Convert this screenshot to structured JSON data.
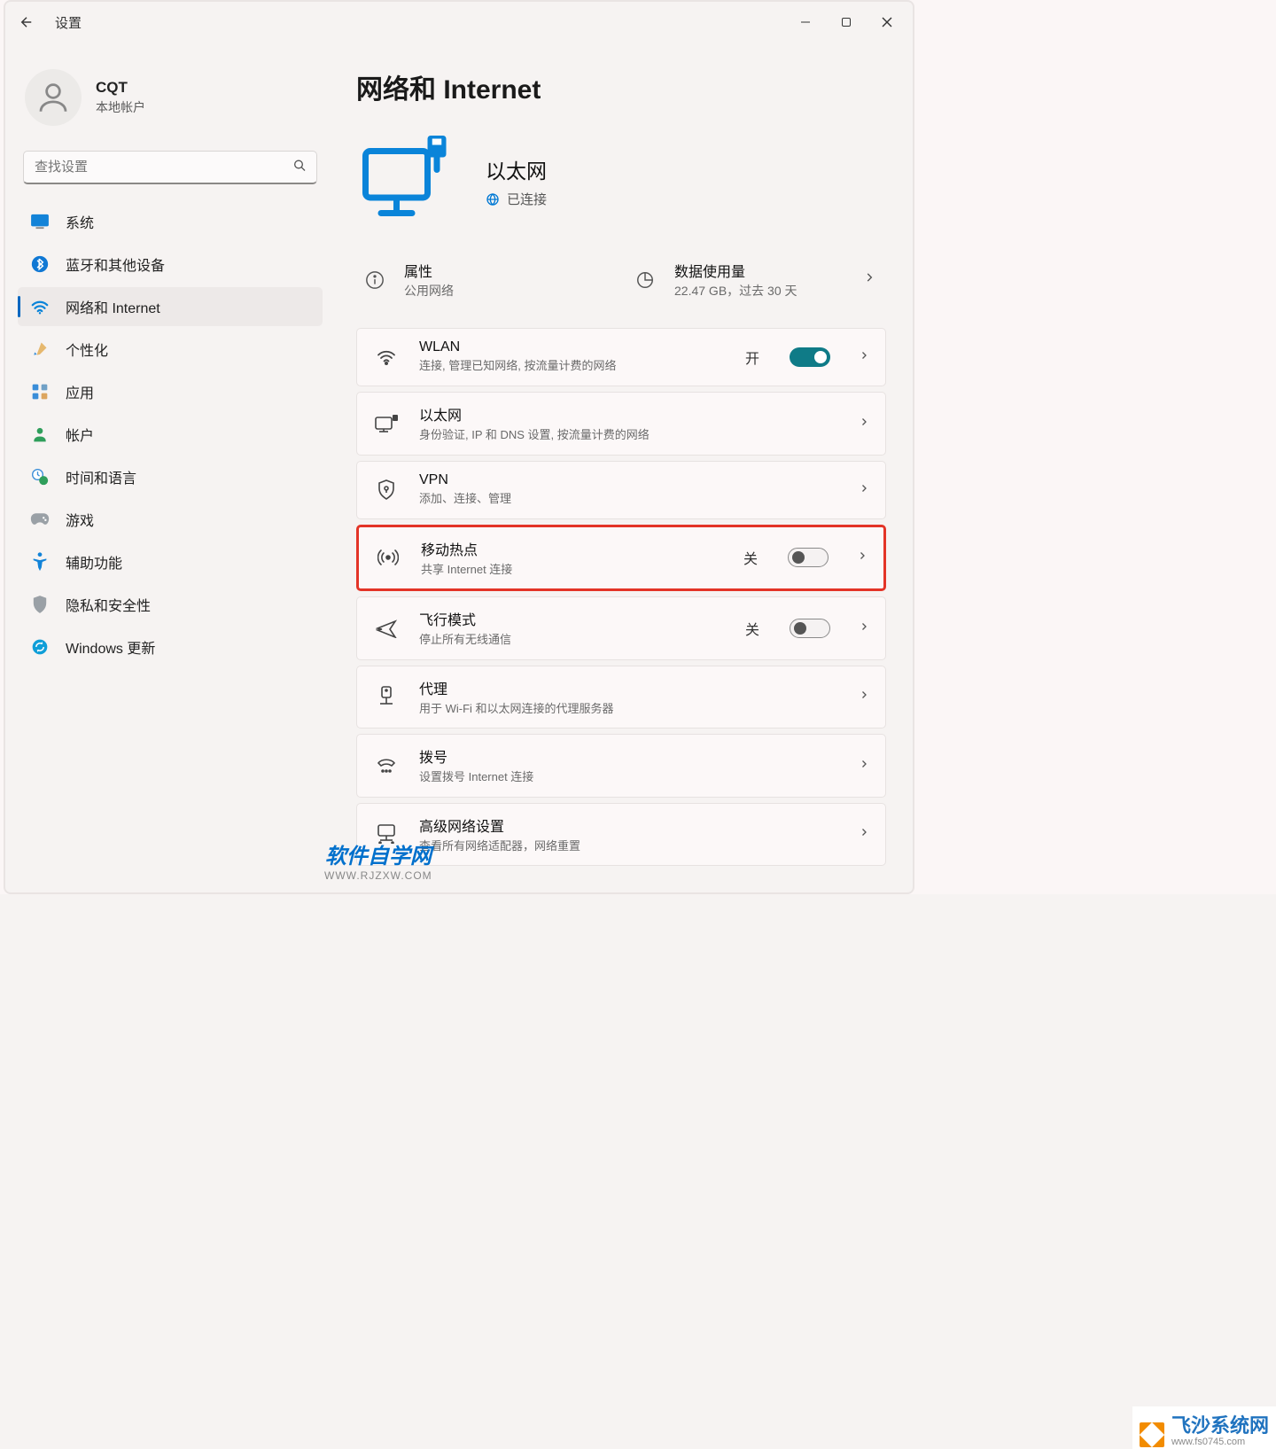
{
  "window": {
    "title": "设置"
  },
  "account": {
    "name": "CQT",
    "sub": "本地帐户"
  },
  "search": {
    "placeholder": "查找设置"
  },
  "nav": {
    "items": [
      {
        "id": "system",
        "label": "系统"
      },
      {
        "id": "bluetooth",
        "label": "蓝牙和其他设备"
      },
      {
        "id": "network",
        "label": "网络和 Internet"
      },
      {
        "id": "personalize",
        "label": "个性化"
      },
      {
        "id": "apps",
        "label": "应用"
      },
      {
        "id": "accounts",
        "label": "帐户"
      },
      {
        "id": "time",
        "label": "时间和语言"
      },
      {
        "id": "gaming",
        "label": "游戏"
      },
      {
        "id": "access",
        "label": "辅助功能"
      },
      {
        "id": "privacy",
        "label": "隐私和安全性"
      },
      {
        "id": "update",
        "label": "Windows 更新"
      }
    ],
    "active": "network"
  },
  "page_title": "网络和 Internet",
  "status": {
    "title": "以太网",
    "sub": "已连接"
  },
  "info": {
    "properties": {
      "title": "属性",
      "sub": "公用网络"
    },
    "data_usage": {
      "title": "数据使用量",
      "sub": "22.47 GB，过去 30 天"
    }
  },
  "cards": [
    {
      "id": "wlan",
      "title": "WLAN",
      "sub": "连接, 管理已知网络, 按流量计费的网络",
      "toggle": "on",
      "state_label": "开"
    },
    {
      "id": "ethernet",
      "title": "以太网",
      "sub": "身份验证, IP 和 DNS 设置, 按流量计费的网络"
    },
    {
      "id": "vpn",
      "title": "VPN",
      "sub": "添加、连接、管理"
    },
    {
      "id": "hotspot",
      "title": "移动热点",
      "sub": "共享 Internet 连接",
      "toggle": "off",
      "state_label": "关",
      "highlight": true
    },
    {
      "id": "airplane",
      "title": "飞行模式",
      "sub": "停止所有无线通信",
      "toggle": "off",
      "state_label": "关"
    },
    {
      "id": "proxy",
      "title": "代理",
      "sub": "用于 Wi-Fi 和以太网连接的代理服务器"
    },
    {
      "id": "dialup",
      "title": "拨号",
      "sub": "设置拨号 Internet 连接"
    },
    {
      "id": "advanced",
      "title": "高级网络设置",
      "sub": "查看所有网络适配器，网络重置"
    }
  ],
  "watermarks": {
    "left": {
      "big": "软件自学网",
      "small": "WWW.RJZXW.COM"
    },
    "brand": {
      "name": "飞沙系统网",
      "url": "www.fs0745.com"
    }
  }
}
